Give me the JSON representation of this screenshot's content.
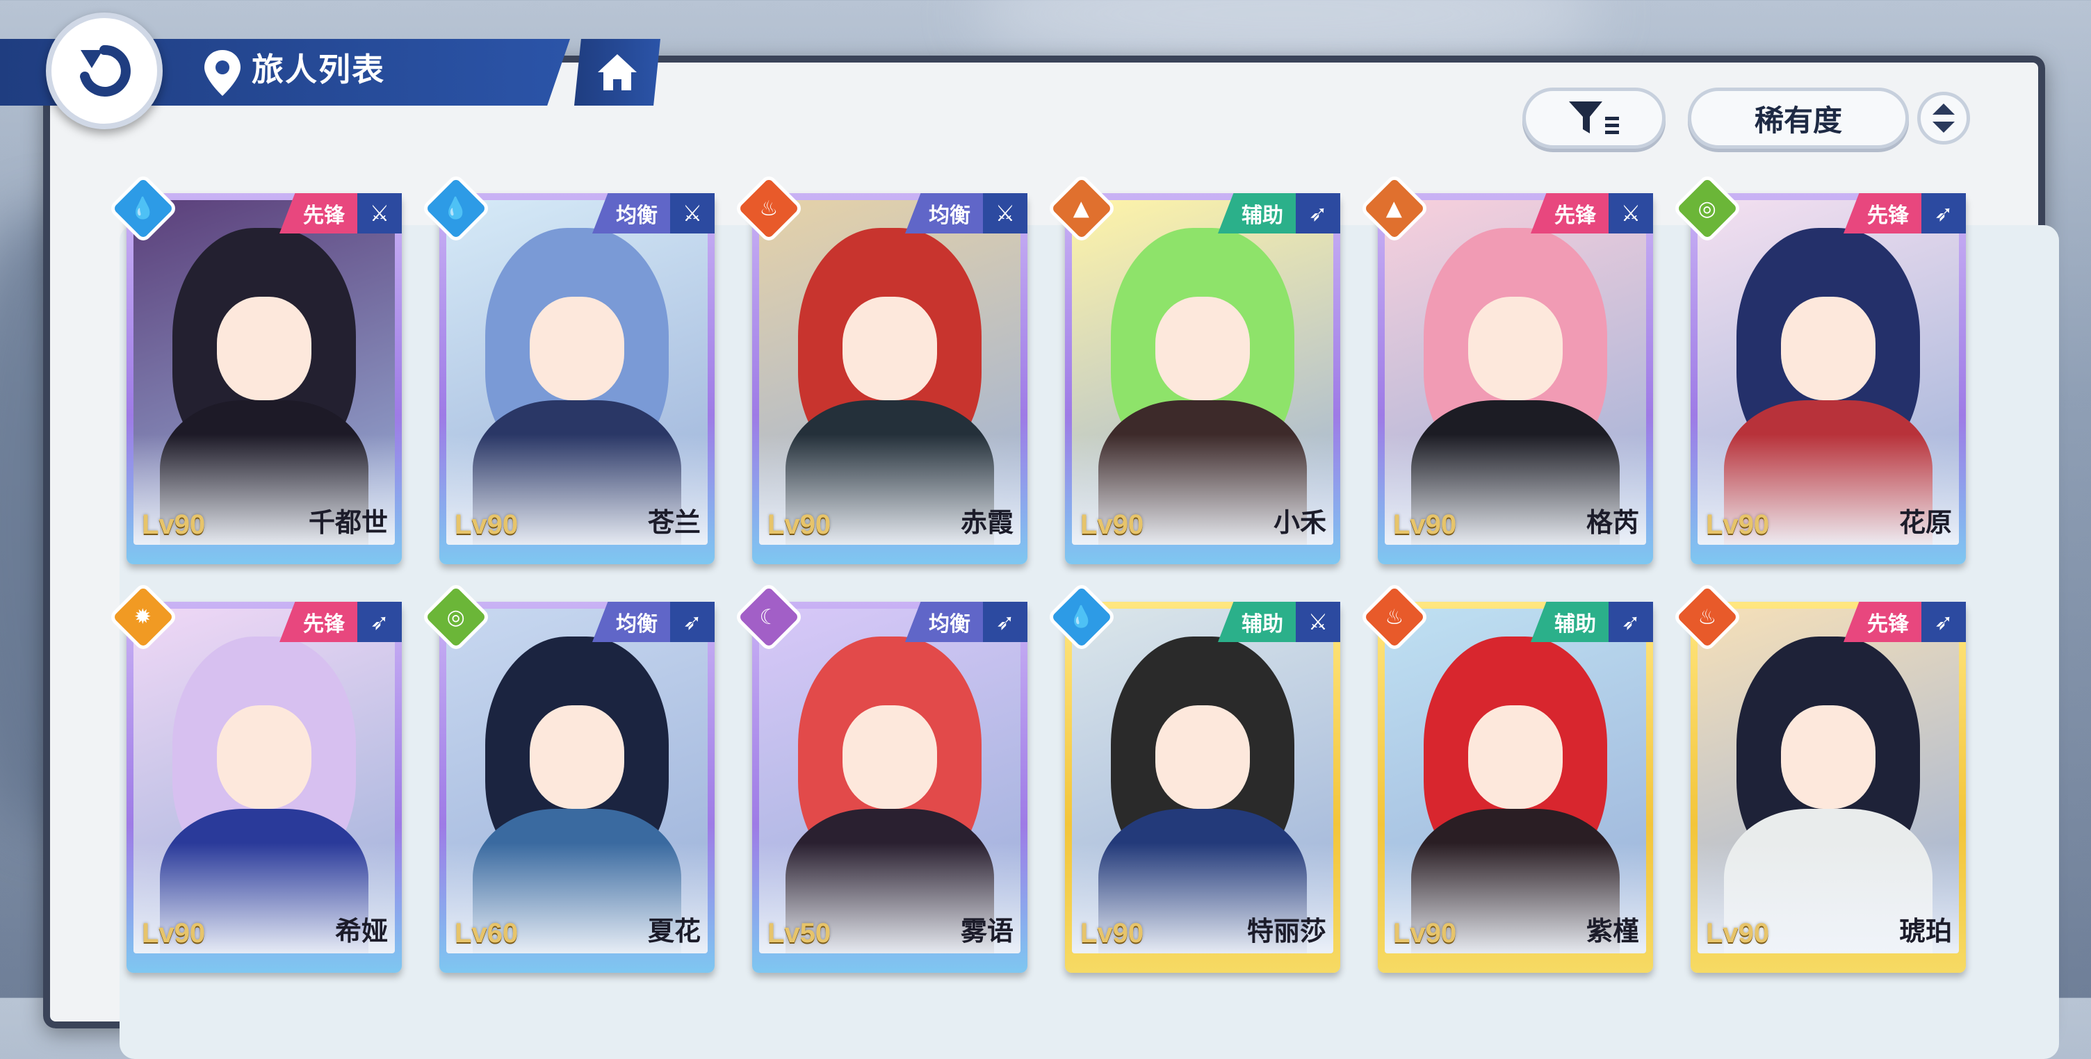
{
  "header": {
    "title": "旅人列表"
  },
  "controls": {
    "sort_label": "稀有度"
  },
  "colors": {
    "water": "#2d9be6",
    "fire": "#e85a2a",
    "earth": "#e0702e",
    "wind": "#6bb638",
    "light": "#f19a23",
    "dark": "#a25fc7",
    "vanguard": "#e8477e",
    "balance": "#6066c8",
    "support": "#2bb08a"
  },
  "travelers": [
    {
      "name": "千都世",
      "level": "Lv90",
      "role": "先锋",
      "element": "water-icon",
      "role_icon": "sword-icon",
      "frame": "purple"
    },
    {
      "name": "苍兰",
      "level": "Lv90",
      "role": "均衡",
      "element": "water-icon",
      "role_icon": "sword-icon",
      "frame": "purple"
    },
    {
      "name": "赤霞",
      "level": "Lv90",
      "role": "均衡",
      "element": "fire-icon",
      "role_icon": "sword-icon",
      "frame": "purple"
    },
    {
      "name": "小禾",
      "level": "Lv90",
      "role": "辅助",
      "element": "earth-icon",
      "role_icon": "bow-icon",
      "frame": "purple"
    },
    {
      "name": "格芮",
      "level": "Lv90",
      "role": "先锋",
      "element": "earth-icon",
      "role_icon": "sword-icon",
      "frame": "purple"
    },
    {
      "name": "花原",
      "level": "Lv90",
      "role": "先锋",
      "element": "wind-icon",
      "role_icon": "bow-icon",
      "frame": "purple"
    },
    {
      "name": "希娅",
      "level": "Lv90",
      "role": "先锋",
      "element": "light-icon",
      "role_icon": "bow-icon",
      "frame": "purple"
    },
    {
      "name": "夏花",
      "level": "Lv60",
      "role": "均衡",
      "element": "wind-icon",
      "role_icon": "bow-icon",
      "frame": "purple"
    },
    {
      "name": "雾语",
      "level": "Lv50",
      "role": "均衡",
      "element": "dark-icon",
      "role_icon": "bow-icon",
      "frame": "purple"
    },
    {
      "name": "特丽莎",
      "level": "Lv90",
      "role": "辅助",
      "element": "water-icon",
      "role_icon": "sword-icon",
      "frame": "gold"
    },
    {
      "name": "紫槿",
      "level": "Lv90",
      "role": "辅助",
      "element": "fire-icon",
      "role_icon": "bow-icon",
      "frame": "gold"
    },
    {
      "name": "琥珀",
      "level": "Lv90",
      "role": "先锋",
      "element": "fire-icon",
      "role_icon": "bow-icon",
      "frame": "gold"
    }
  ]
}
